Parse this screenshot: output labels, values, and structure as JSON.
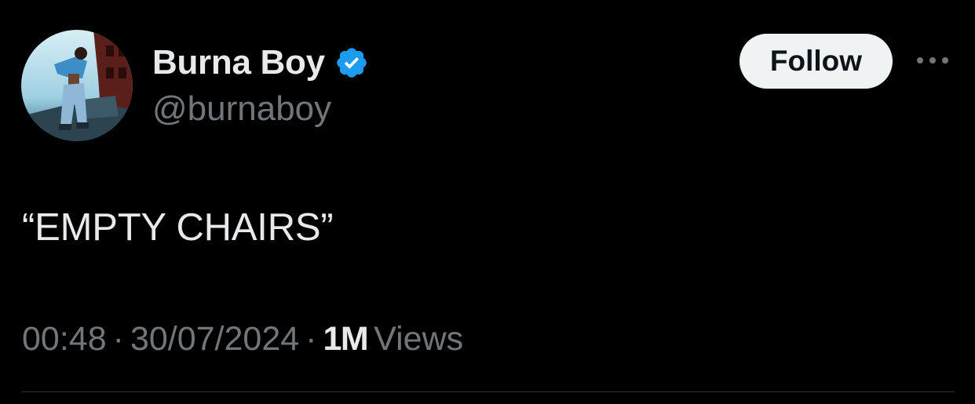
{
  "user": {
    "display_name": "Burna Boy",
    "handle": "@burnaboy",
    "verified": true,
    "verified_color": "#1d9bf0",
    "avatar_icon": "profile-photo"
  },
  "actions": {
    "follow_label": "Follow",
    "more_icon": "more-horizontal-icon"
  },
  "tweet": {
    "text": "“EMPTY CHAIRS”"
  },
  "meta": {
    "time": "00:48",
    "date": "30/07/2024",
    "separator": "·",
    "views_count": "1M",
    "views_label": "Views"
  },
  "colors": {
    "background": "#000000",
    "primary_text": "#e7e9ea",
    "secondary_text": "#71767b",
    "button_bg": "#eff3f4",
    "divider": "#2f3336"
  }
}
